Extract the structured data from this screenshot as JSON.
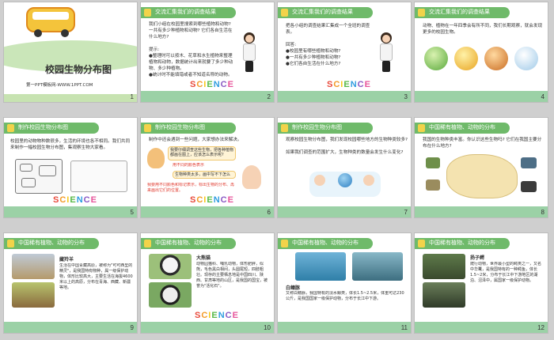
{
  "science_word": "SCIENCE",
  "slides": [
    {
      "num": "1",
      "title": "校园生物分布图",
      "subtitle": "第一PPT模板网-WWW.1PPT.COM"
    },
    {
      "num": "2",
      "header": "交流汇集我们的调查结果",
      "body": "我们小组在校园里搜索到哪些植物和动物? 一共有多少种植物和动物? 它们各自生活在什么地方?\n\n提示:\n●整理时可以按木、花草和水生植物来整理植物和动物，数据统计出来就要了多少种动物、多少种植物。\n●统计时不能填错或者不知道名称的动物。"
    },
    {
      "num": "3",
      "header": "交流汇集我们的调查结果",
      "body": "把各小组的调查结果汇集成一个全班的调查表。\n\n回答:\n●校园里有哪些植物和动物?\n●一共有多少种植物和动物?\n●它们各自生活在什么地方?"
    },
    {
      "num": "4",
      "header": "交流汇集我们的调查结果",
      "body": "动物、植物在一年四季会有所不同，我们长期观察，就会发现更多的校园生物。"
    },
    {
      "num": "5",
      "header": "制作校园生物分布图",
      "body": "校园里的动物物种数很多，生活的环境也各不相同。我们共同来制作一幅校园生物分布图，集观察生物大家看。"
    },
    {
      "num": "6",
      "header": "制作校园生物分布图",
      "body": "制作中还会遇到一些问题，大家想办法来解决。",
      "bubble1": "我要仔细调查这些生物，把各种植物都画在图上，应该怎么表示呢?",
      "bubble2": "用不同的颜色表示",
      "bubble3": "生物种类太多，画中写不下怎么办?",
      "note": "我要用不同颜色和标记表示，标出生物的分布、再来画出它们的位置。"
    },
    {
      "num": "7",
      "header": "制作校园生物分布图",
      "body": "观察校园生物分布图，我们发现校园哪些地方的生物种类较多?\n\n如果我们调查的范围扩大，生物种类的数量会发生什么变化?"
    },
    {
      "num": "8",
      "header": "中国稀有植物、动物的分布",
      "body": "我国的生物种类丰富。你认识这些生物吗? 它们在我国主要分布在什么地方?"
    },
    {
      "num": "9",
      "header": "中国稀有植物、动物的分布",
      "animal": "藏羚羊",
      "body": "生活在中国青藏高原，被称为\"可可西里的精灵\"，是我国特有物种，属一级保护动物，体形比较高大，主要生活在海拔4600米以上的高原，分布在青海、西藏、新疆等地。"
    },
    {
      "num": "10",
      "header": "中国稀有植物、动物的分布",
      "animal": "大熊猫",
      "body": "动物园猫科、哺乳动物，体形肥胖，似熊，毛色黑白相间，头圆尾短，四肢粗壮。现存的主要栖息地是中国四川、陕西、甘肃等地的山区，是我国的国宝，被誉为\"活化石\"。"
    },
    {
      "num": "11",
      "header": "中国稀有植物、动物的分布",
      "animal": "白鳍豚",
      "body": "又称白鳍豚，我国特有的淡水鲸类，体长1.5~2.5米，体重可达230公斤，是我国国家一级保护动物，分布于长江中下游。"
    },
    {
      "num": "12",
      "header": "中国稀有植物、动物的分布",
      "animal": "扬子鳄",
      "body": "爬行动物，世界最小型的鳄类之一，又名中华鼍，是我国特有的一种鳄鱼，体长1.5~2米，分布于长江中下游地区的湖泊、沼泽中，属国家一级保护动物。"
    }
  ]
}
